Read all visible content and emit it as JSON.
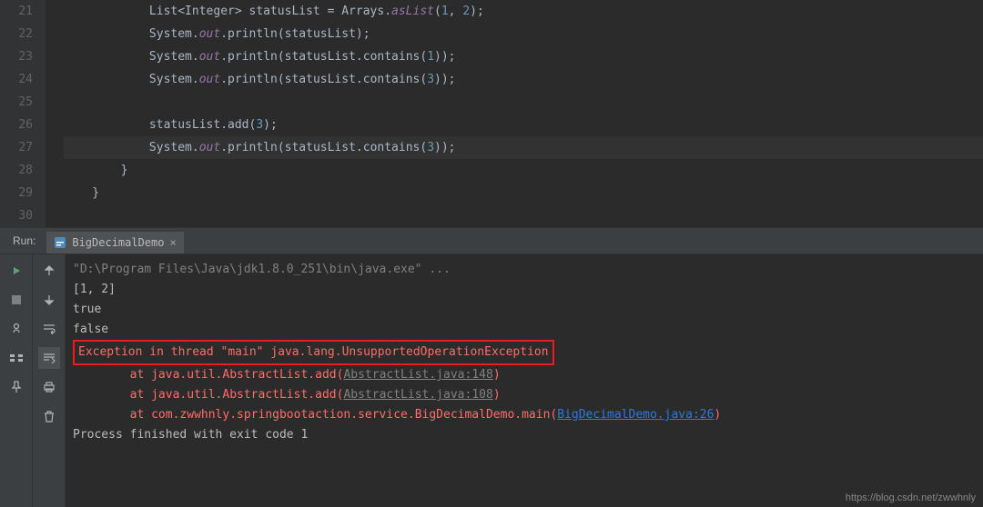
{
  "gutter": [
    "21",
    "22",
    "23",
    "24",
    "25",
    "26",
    "27",
    "28",
    "29",
    "30"
  ],
  "code": {
    "line21": {
      "indent": "            ",
      "p1": "List<Integer> statusList = Arrays.",
      "m1": "asList",
      "p2": "(",
      "n1": "1",
      "p3": ", ",
      "n2": "2",
      "p4": ");"
    },
    "line22": {
      "indent": "            ",
      "p1": "System.",
      "f1": "out",
      "p2": ".println(statusList);"
    },
    "line23": {
      "indent": "            ",
      "p1": "System.",
      "f1": "out",
      "p2": ".println(statusList.contains(",
      "n1": "1",
      "p3": "));"
    },
    "line24": {
      "indent": "            ",
      "p1": "System.",
      "f1": "out",
      "p2": ".println(statusList.contains(",
      "n1": "3",
      "p3": "));"
    },
    "line25": "",
    "line26": {
      "indent": "            ",
      "p1": "statusList.add(",
      "n1": "3",
      "p2": ");"
    },
    "line27": {
      "indent": "            ",
      "p1": "System.",
      "f1": "out",
      "p2": ".println(statusList.contains(",
      "n1": "3",
      "p3": "));"
    },
    "line28": "        }",
    "line29": "    }",
    "line30": ""
  },
  "runLabel": "Run:",
  "runTab": "BigDecimalDemo",
  "console": {
    "l1": "\"D:\\Program Files\\Java\\jdk1.8.0_251\\bin\\java.exe\" ...",
    "l2": "[1, 2]",
    "l3": "true",
    "l4": "false",
    "l5": "Exception in thread \"main\" java.lang.UnsupportedOperationException",
    "l6a": "\tat java.util.AbstractList.add(",
    "l6b": "AbstractList.java:148",
    "l6c": ")",
    "l7a": "\tat java.util.AbstractList.add(",
    "l7b": "AbstractList.java:108",
    "l7c": ")",
    "l8a": "\tat com.zwwhnly.springbootaction.service.BigDecimalDemo.main(",
    "l8b": "BigDecimalDemo.java:26",
    "l8c": ")",
    "l9": "",
    "l10": "Process finished with exit code 1"
  },
  "watermark": "https://blog.csdn.net/zwwhnly"
}
